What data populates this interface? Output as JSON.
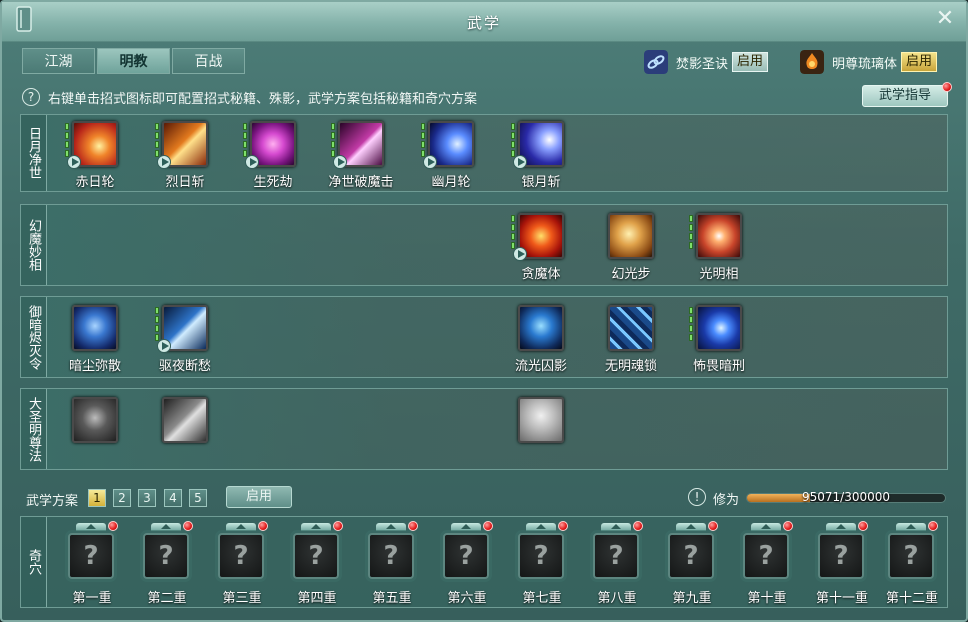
{
  "window": {
    "title": "武学",
    "close_icon": "close-icon"
  },
  "tabs": [
    {
      "label": "江湖",
      "active": false
    },
    {
      "label": "明教",
      "active": true
    },
    {
      "label": "百战",
      "active": false
    }
  ],
  "stances": [
    {
      "icon": "chain-link-icon",
      "label": "焚影圣诀",
      "button": "启用",
      "active": false
    },
    {
      "icon": "flame-figure-icon",
      "label": "明尊琉璃体",
      "button": "启用",
      "active": true
    }
  ],
  "tip": {
    "icon": "help-icon",
    "text": "右键单击招式图标即可配置招式秘籍、殊影，武学方案包括秘籍和奇穴方案"
  },
  "guide_button": "武学指导",
  "rows": [
    {
      "label": "日月净世",
      "skills": [
        {
          "name": "赤日轮",
          "color": "#d9562a"
        },
        {
          "name": "烈日斩",
          "color": "#e37a1e"
        },
        {
          "name": "生死劫",
          "color": "#b21fa6"
        },
        {
          "name": "净世破魔击",
          "color": "#a52c8f"
        },
        {
          "name": "幽月轮",
          "color": "#2a4fd1"
        },
        {
          "name": "银月斩",
          "color": "#3b3fc7"
        }
      ]
    },
    {
      "label": "幻魔妙相",
      "skills": [
        {
          "name": "贪魔体",
          "color": "#d33a12"
        },
        {
          "name": "幻光步",
          "color": "#d99632"
        },
        {
          "name": "光明相",
          "color": "#c9542c"
        }
      ]
    },
    {
      "label": "御暗烬灭令",
      "skills": [
        {
          "name": "暗尘弥散",
          "color": "#2b5bb5"
        },
        {
          "name": "驱夜断愁",
          "color": "#2e74c9"
        },
        {
          "name": "流光囚影",
          "color": "#1f5fa8"
        },
        {
          "name": "无明魂锁",
          "color": "#2d6fc0"
        },
        {
          "name": "怖畏暗刑",
          "color": "#2a58c2"
        }
      ]
    },
    {
      "label": "大圣明尊法",
      "skills": [
        {
          "name": "",
          "color": "#4a4a4a"
        },
        {
          "name": "",
          "color": "#555555"
        },
        {
          "name": "",
          "color": "#9a9a9a"
        }
      ]
    }
  ],
  "plan": {
    "label": "武学方案",
    "numbers": [
      "1",
      "2",
      "3",
      "4",
      "5"
    ],
    "active_index": 0,
    "enable_button": "启用"
  },
  "xiuwei": {
    "icon": "alert-icon",
    "label": "修为",
    "current": 95071,
    "max": 300000,
    "text": "95071/300000"
  },
  "qixue": {
    "label": "奇穴",
    "slots": [
      "第一重",
      "第二重",
      "第三重",
      "第四重",
      "第五重",
      "第六重",
      "第七重",
      "第八重",
      "第九重",
      "第十重",
      "第十一重",
      "第十二重"
    ],
    "empty_symbol": "?"
  }
}
